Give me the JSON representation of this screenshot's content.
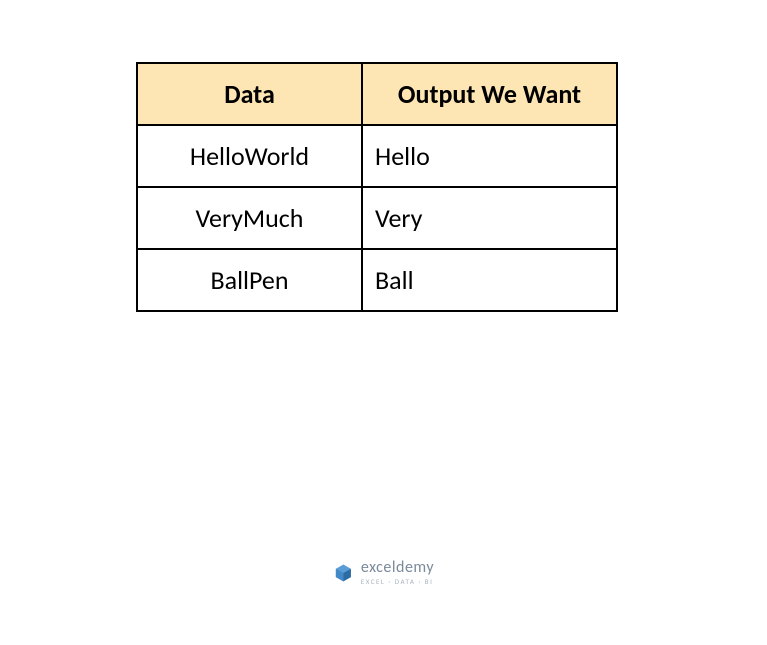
{
  "chart_data": {
    "type": "table",
    "headers": [
      "Data",
      "Output We Want"
    ],
    "rows": [
      [
        "HelloWorld",
        "Hello"
      ],
      [
        "VeryMuch",
        "Very"
      ],
      [
        "BallPen",
        "Ball"
      ]
    ]
  },
  "table": {
    "header_data": "Data",
    "header_output": "Output We Want",
    "rows": [
      {
        "data": "HelloWorld",
        "output": "Hello"
      },
      {
        "data": "VeryMuch",
        "output": "Very"
      },
      {
        "data": "BallPen",
        "output": "Ball"
      }
    ]
  },
  "logo": {
    "title": "exceldemy",
    "subtitle": "EXCEL · DATA · BI"
  }
}
